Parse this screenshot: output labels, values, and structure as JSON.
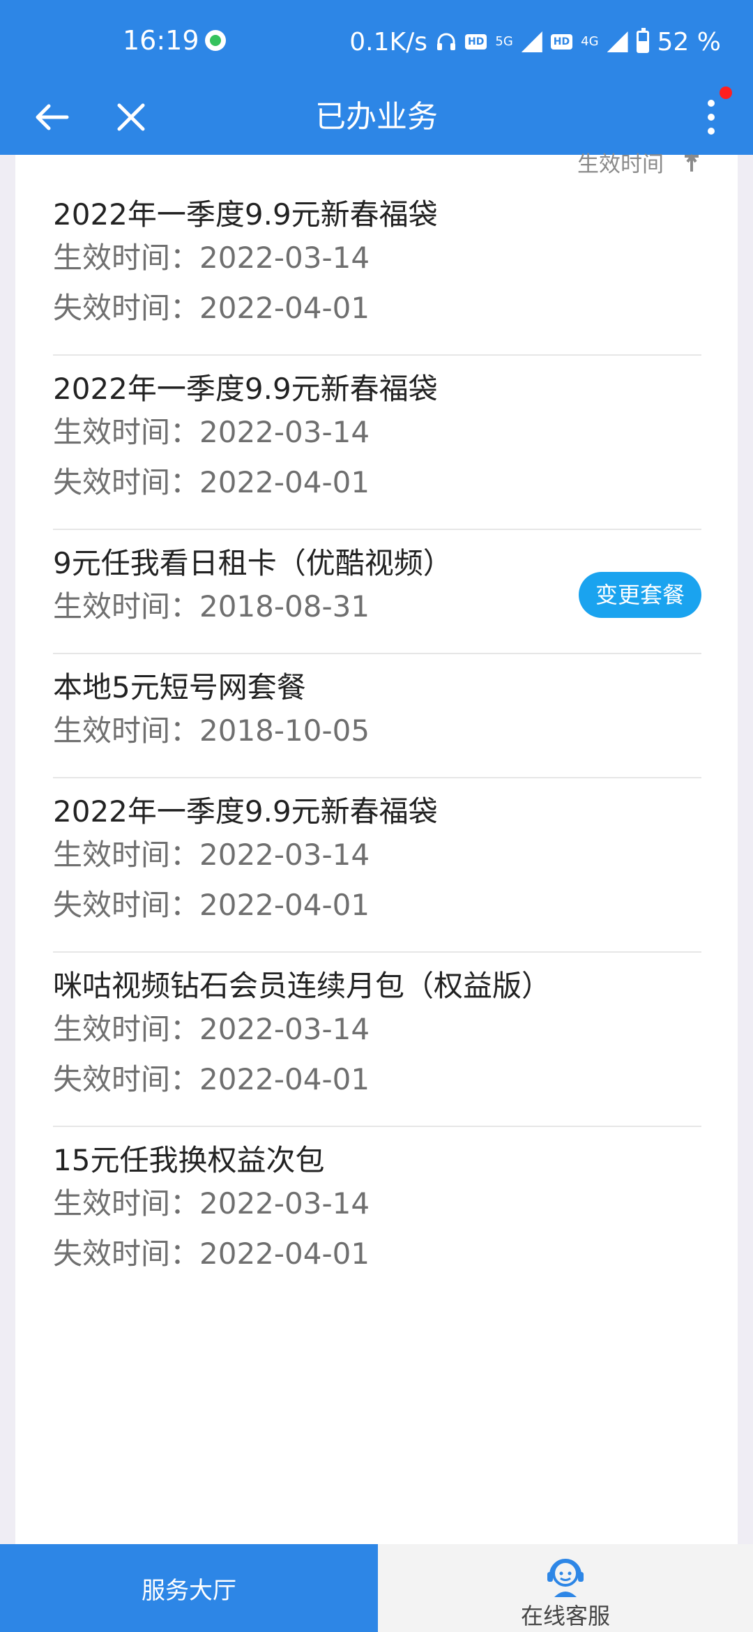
{
  "status_bar": {
    "time": "16:19",
    "net_speed": "0.1K/s",
    "hd1": "HD",
    "net1": "5G",
    "hd2": "HD",
    "net2": "4G",
    "battery": "52 %"
  },
  "header": {
    "title": "已办业务",
    "back_icon": "arrow-left-icon",
    "close_icon": "close-icon",
    "more_icon": "more-vertical-icon",
    "accent": "#2d86e6",
    "notify_color": "#ff1f1f"
  },
  "sort": {
    "label": "生效时间"
  },
  "labels": {
    "effective": "生效时间：",
    "expire": "失效时间："
  },
  "items": [
    {
      "name": "2022年一季度9.9元新春福袋",
      "effective": "2022-03-14",
      "expire": "2022-04-01"
    },
    {
      "name": "2022年一季度9.9元新春福袋",
      "effective": "2022-03-14",
      "expire": "2022-04-01"
    },
    {
      "name": "9元任我看日租卡（优酷视频）",
      "effective": "2018-08-31",
      "action": "变更套餐"
    },
    {
      "name": "本地5元短号网套餐",
      "effective": "2018-10-05"
    },
    {
      "name": "2022年一季度9.9元新春福袋",
      "effective": "2022-03-14",
      "expire": "2022-04-01"
    },
    {
      "name": "咪咕视频钻石会员连续月包（权益版）",
      "effective": "2022-03-14",
      "expire": "2022-04-01"
    },
    {
      "name": "15元任我换权益次包",
      "effective": "2022-03-14",
      "expire": "2022-04-01"
    }
  ],
  "bottom_nav": {
    "hall": "服务大厅",
    "service": "在线客服",
    "service_icon": "customer-service-icon"
  }
}
